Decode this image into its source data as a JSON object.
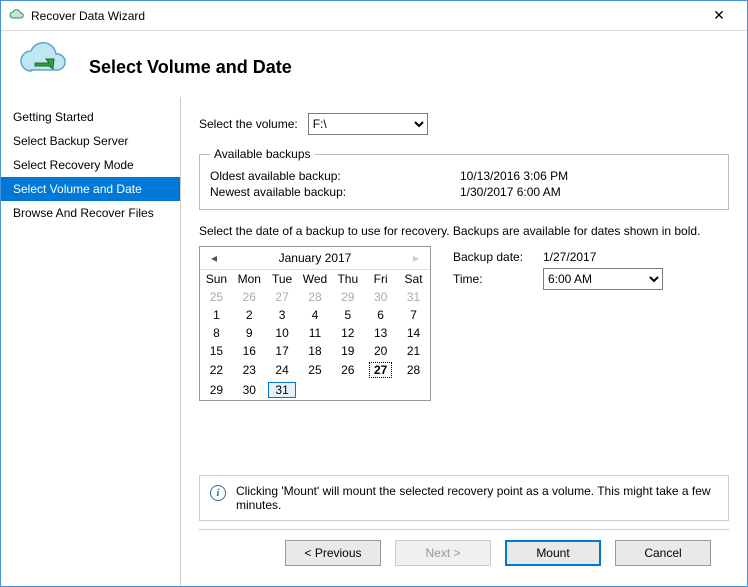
{
  "window": {
    "title": "Recover Data Wizard",
    "close_glyph": "✕"
  },
  "header": {
    "heading": "Select Volume and Date"
  },
  "sidebar": {
    "items": [
      {
        "label": "Getting Started",
        "active": false
      },
      {
        "label": "Select Backup Server",
        "active": false
      },
      {
        "label": "Select Recovery Mode",
        "active": false
      },
      {
        "label": "Select Volume and Date",
        "active": true
      },
      {
        "label": "Browse And Recover Files",
        "active": false
      }
    ]
  },
  "main": {
    "select_volume_label": "Select the volume:",
    "volume_value": "F:\\",
    "available_legend": "Available backups",
    "oldest_label": "Oldest available backup:",
    "oldest_value": "10/13/2016 3:06 PM",
    "newest_label": "Newest available backup:",
    "newest_value": "1/30/2017 6:00 AM",
    "instruction": "Select the date of a backup to use for recovery. Backups are available for dates shown in bold.",
    "backup_date_label": "Backup date:",
    "backup_date_value": "1/27/2017",
    "time_label": "Time:",
    "time_value": "6:00 AM",
    "info_text": "Clicking 'Mount' will mount the selected recovery point as a volume. This might take a few minutes."
  },
  "calendar": {
    "month_label": "January 2017",
    "prev_glyph": "◂",
    "next_glyph": "▸",
    "day_headers": [
      "Sun",
      "Mon",
      "Tue",
      "Wed",
      "Thu",
      "Fri",
      "Sat"
    ],
    "weeks": [
      [
        {
          "d": "25",
          "cls": "other"
        },
        {
          "d": "26",
          "cls": "other"
        },
        {
          "d": "27",
          "cls": "other"
        },
        {
          "d": "28",
          "cls": "other"
        },
        {
          "d": "29",
          "cls": "other"
        },
        {
          "d": "30",
          "cls": "other"
        },
        {
          "d": "31",
          "cls": "other"
        }
      ],
      [
        {
          "d": "1",
          "cls": ""
        },
        {
          "d": "2",
          "cls": ""
        },
        {
          "d": "3",
          "cls": ""
        },
        {
          "d": "4",
          "cls": ""
        },
        {
          "d": "5",
          "cls": ""
        },
        {
          "d": "6",
          "cls": ""
        },
        {
          "d": "7",
          "cls": ""
        }
      ],
      [
        {
          "d": "8",
          "cls": ""
        },
        {
          "d": "9",
          "cls": "bold"
        },
        {
          "d": "10",
          "cls": ""
        },
        {
          "d": "11",
          "cls": ""
        },
        {
          "d": "12",
          "cls": ""
        },
        {
          "d": "13",
          "cls": "bold"
        },
        {
          "d": "14",
          "cls": "bold"
        }
      ],
      [
        {
          "d": "15",
          "cls": "bold"
        },
        {
          "d": "16",
          "cls": "bold"
        },
        {
          "d": "17",
          "cls": "bold"
        },
        {
          "d": "18",
          "cls": "bold"
        },
        {
          "d": "19",
          "cls": "bold"
        },
        {
          "d": "20",
          "cls": "bold"
        },
        {
          "d": "21",
          "cls": "bold"
        }
      ],
      [
        {
          "d": "22",
          "cls": "bold"
        },
        {
          "d": "23",
          "cls": "bold"
        },
        {
          "d": "24",
          "cls": "bold"
        },
        {
          "d": "25",
          "cls": "bold"
        },
        {
          "d": "26",
          "cls": "bold"
        },
        {
          "d": "27",
          "cls": "bold selected"
        },
        {
          "d": "28",
          "cls": "bold"
        }
      ],
      [
        {
          "d": "29",
          "cls": "bold"
        },
        {
          "d": "30",
          "cls": "bold"
        },
        {
          "d": "31",
          "cls": "today"
        },
        {
          "d": "",
          "cls": ""
        },
        {
          "d": "",
          "cls": ""
        },
        {
          "d": "",
          "cls": ""
        },
        {
          "d": "",
          "cls": ""
        }
      ]
    ]
  },
  "footer": {
    "previous": "< Previous",
    "next": "Next >",
    "mount": "Mount",
    "cancel": "Cancel"
  }
}
